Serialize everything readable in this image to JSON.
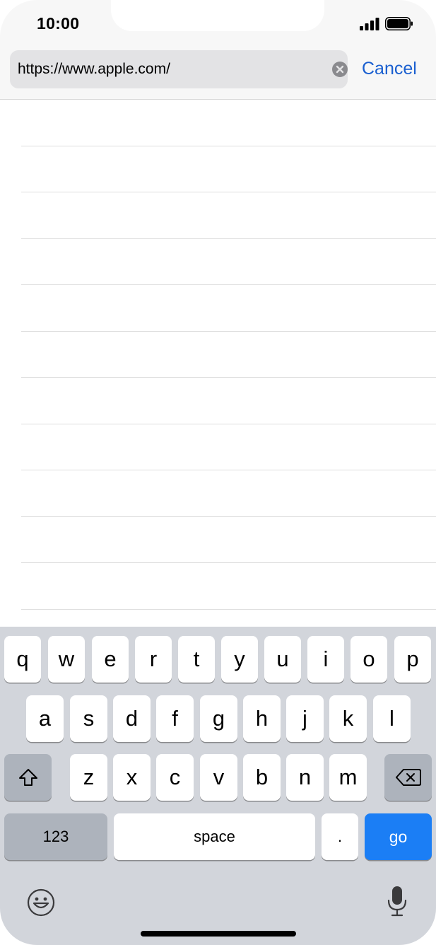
{
  "status_bar": {
    "time": "10:00"
  },
  "url_bar": {
    "url": "https://www.apple.com/",
    "cancel_label": "Cancel"
  },
  "keyboard": {
    "row1": [
      "q",
      "w",
      "e",
      "r",
      "t",
      "y",
      "u",
      "i",
      "o",
      "p"
    ],
    "row2": [
      "a",
      "s",
      "d",
      "f",
      "g",
      "h",
      "j",
      "k",
      "l"
    ],
    "row3": [
      "z",
      "x",
      "c",
      "v",
      "b",
      "n",
      "m"
    ],
    "numbers_label": "123",
    "space_label": "space",
    "period_label": ".",
    "go_label": "go"
  },
  "icons": {
    "signal": "signal-icon",
    "battery": "battery-icon",
    "clear": "clear-icon",
    "shift": "shift-icon",
    "delete": "delete-icon",
    "emoji": "emoji-icon",
    "microphone": "microphone-icon"
  },
  "colors": {
    "accent": "#1a5fd0",
    "go_key": "#1b7ef5",
    "keyboard_bg": "#d2d5db"
  }
}
